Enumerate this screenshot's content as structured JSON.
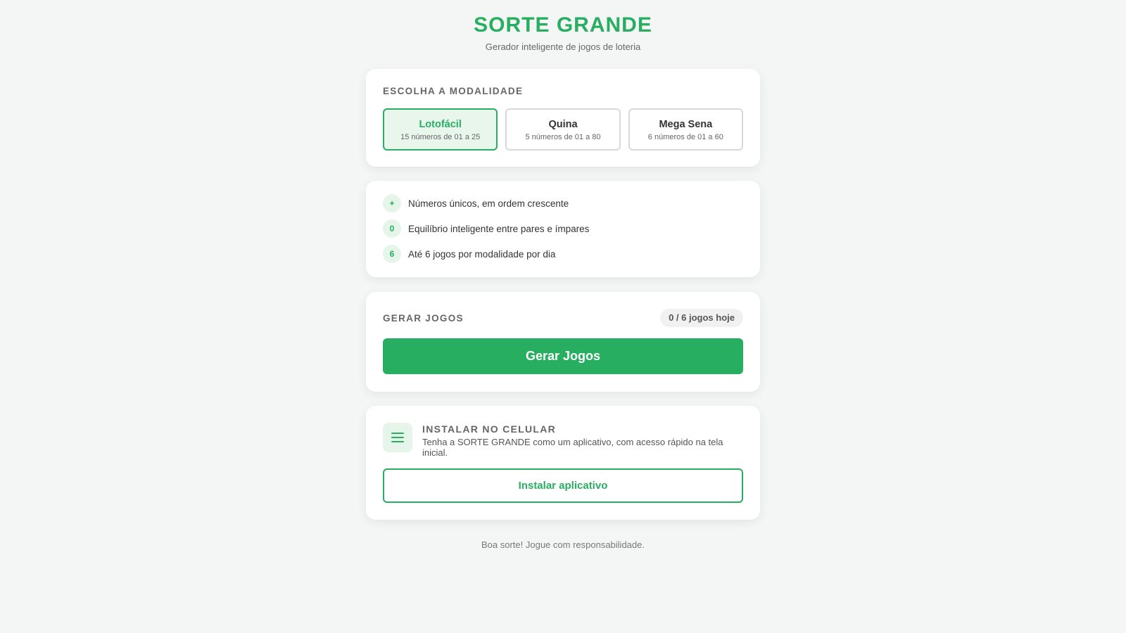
{
  "header": {
    "title": "SORTE GRANDE",
    "subtitle": "Gerador inteligente de jogos de loteria"
  },
  "modality": {
    "title": "ESCOLHA A MODALIDADE",
    "selected": "Lotofácil",
    "options": [
      {
        "name": "Lotofácil",
        "desc": "15 números de 01 a 25"
      },
      {
        "name": "Quina",
        "desc": "5 números de 01 a 80"
      },
      {
        "name": "Mega Sena",
        "desc": "6 números de 01 a 60"
      }
    ]
  },
  "features": [
    {
      "badge": "+",
      "text": "Números únicos, em ordem crescente"
    },
    {
      "badge": "0",
      "text": "Equilíbrio inteligente entre pares e ímpares"
    },
    {
      "badge": "6",
      "text": "Até 6 jogos por modalidade por dia"
    }
  ],
  "generate": {
    "title": "GERAR JOGOS",
    "count": "0 / 6 jogos hoje",
    "button": "Gerar Jogos"
  },
  "install": {
    "icon": "menu-icon",
    "title": "INSTALAR NO CELULAR",
    "desc": "Tenha a SORTE GRANDE como um aplicativo, com acesso rápido na tela inicial.",
    "button": "Instalar aplicativo"
  },
  "footer": {
    "text": "Boa sorte! Jogue com responsabilidade."
  },
  "colors": {
    "accent": "#27ae60",
    "accent_light": "#e8f6ec",
    "background": "#f4f6f5"
  }
}
